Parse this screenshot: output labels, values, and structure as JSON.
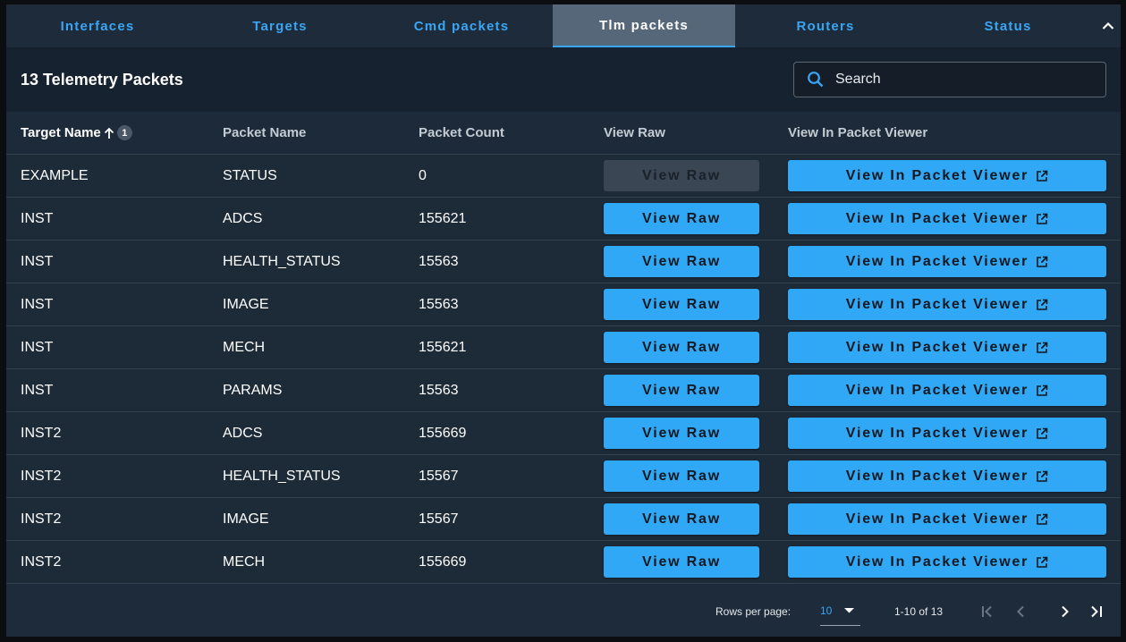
{
  "tabs": [
    {
      "label": "Interfaces",
      "active": false
    },
    {
      "label": "Targets",
      "active": false
    },
    {
      "label": "Cmd packets",
      "active": false
    },
    {
      "label": "Tlm packets",
      "active": true
    },
    {
      "label": "Routers",
      "active": false
    },
    {
      "label": "Status",
      "active": false
    }
  ],
  "header": {
    "title": "13 Telemetry Packets",
    "search_placeholder": "Search"
  },
  "table": {
    "columns": [
      "Target Name",
      "Packet Name",
      "Packet Count",
      "View Raw",
      "View In Packet Viewer"
    ],
    "sort_badge": "1",
    "rows": [
      {
        "target": "EXAMPLE",
        "packet": "STATUS",
        "count": "0",
        "raw": "View Raw",
        "viewer": "View In Packet Viewer",
        "raw_disabled": true
      },
      {
        "target": "INST",
        "packet": "ADCS",
        "count": "155621",
        "raw": "View Raw",
        "viewer": "View In Packet Viewer"
      },
      {
        "target": "INST",
        "packet": "HEALTH_STATUS",
        "count": "15563",
        "raw": "View Raw",
        "viewer": "View In Packet Viewer"
      },
      {
        "target": "INST",
        "packet": "IMAGE",
        "count": "15563",
        "raw": "View Raw",
        "viewer": "View In Packet Viewer"
      },
      {
        "target": "INST",
        "packet": "MECH",
        "count": "155621",
        "raw": "View Raw",
        "viewer": "View In Packet Viewer"
      },
      {
        "target": "INST",
        "packet": "PARAMS",
        "count": "15563",
        "raw": "View Raw",
        "viewer": "View In Packet Viewer"
      },
      {
        "target": "INST2",
        "packet": "ADCS",
        "count": "155669",
        "raw": "View Raw",
        "viewer": "View In Packet Viewer"
      },
      {
        "target": "INST2",
        "packet": "HEALTH_STATUS",
        "count": "15567",
        "raw": "View Raw",
        "viewer": "View In Packet Viewer"
      },
      {
        "target": "INST2",
        "packet": "IMAGE",
        "count": "15567",
        "raw": "View Raw",
        "viewer": "View In Packet Viewer"
      },
      {
        "target": "INST2",
        "packet": "MECH",
        "count": "155669",
        "raw": "View Raw",
        "viewer": "View In Packet Viewer"
      }
    ]
  },
  "footer": {
    "rows_per_page_label": "Rows per page:",
    "rows_per_page_value": "10",
    "range": "1-10 of 13"
  },
  "colors": {
    "accent": "#3aa6f3",
    "button": "#31a8f5",
    "panel": "#1e2b3a"
  }
}
